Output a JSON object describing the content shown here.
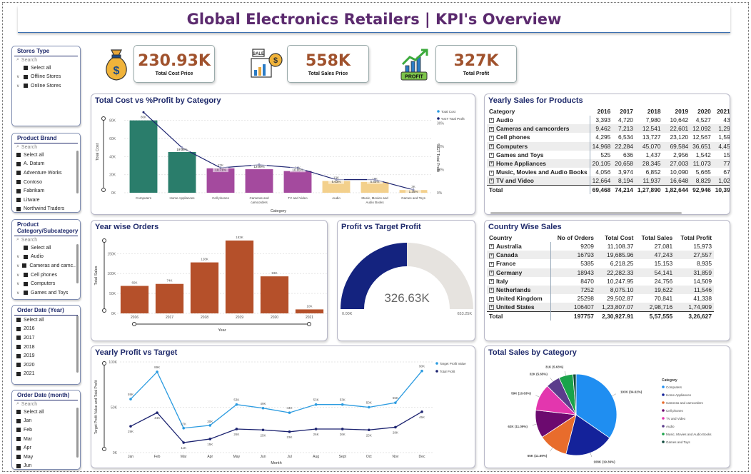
{
  "title": "Global Electronics Retailers | KPI's Overview",
  "kpis": [
    {
      "value": "230.93K",
      "label": "Total Cost Price",
      "icon": "money-bag-icon"
    },
    {
      "value": "558K",
      "label": "Total Sales Price",
      "icon": "sale-chart-icon"
    },
    {
      "value": "327K",
      "label": "Total Profit",
      "icon": "profit-chart-icon"
    }
  ],
  "slicers": {
    "stores": {
      "title": "Stores Type",
      "search": "Search",
      "items": [
        "Select all",
        "Offline Stores",
        "Online Stores"
      ]
    },
    "brand": {
      "title": "Product Brand",
      "search": "Search",
      "items": [
        "Select all",
        "A. Datum",
        "Adventure Works",
        "Contoso",
        "Fabrikam",
        "Litware",
        "Northwind Traders"
      ]
    },
    "category": {
      "title": "Product Category/Subcategory",
      "search": "Search",
      "items": [
        "Select all",
        "Audio",
        "Cameras and camc..",
        "Cell phones",
        "Computers",
        "Games and Toys"
      ]
    },
    "year": {
      "title": "Order Date (Year)",
      "items": [
        "Select all",
        "2016",
        "2017",
        "2018",
        "2019",
        "2020",
        "2021"
      ]
    },
    "month": {
      "title": "Order Date (month)",
      "search": "Search",
      "items": [
        "Select all",
        "Jan",
        "Feb",
        "Mar",
        "Apr",
        "May",
        "Jun"
      ]
    }
  },
  "cost_chart": {
    "title": "Total Cost vs %Profit by Category",
    "legend": [
      "Total Cost",
      "%GT Total Profit"
    ],
    "xlabel": "Category",
    "ylabel": "Total Cost",
    "y2label": "%GT Total Profit",
    "yticks": [
      "80K",
      "60K",
      "40K",
      "20K",
      "0K"
    ],
    "y2ticks": [
      "30%",
      "20%",
      "10%",
      "0%"
    ]
  },
  "year_chart": {
    "title": "Year wise Orders",
    "xlabel": "Year",
    "ylabel": "Total Sales",
    "yticks": [
      "150K",
      "100K",
      "50K",
      "0K"
    ]
  },
  "gauge": {
    "title": "Profit vs Target Profit",
    "value_label": "326.63K",
    "min_label": "0.00K",
    "max_label": "653.25K",
    "value": 326.63,
    "max": 653.25
  },
  "profit_chart": {
    "title": "Yearly Profit vs Target",
    "legend": [
      "Target Profit Value",
      "Total Profit"
    ],
    "xlabel": "Month",
    "ylabel": "Target Profit Value and Total Profit",
    "yticks": [
      "100K",
      "50K",
      "0K"
    ]
  },
  "pie_chart": {
    "title": "Total Sales by Category",
    "legend_title": "Category"
  },
  "yearly_sales": {
    "title": "Yearly Sales for Products",
    "headers": [
      "Category",
      "2016",
      "2017",
      "2018",
      "2019",
      "2020",
      "2021"
    ],
    "rows": [
      [
        "Audio",
        "3,393",
        "4,720",
        "7,980",
        "10,642",
        "4,527",
        "43"
      ],
      [
        "Cameras and camcorders",
        "9,462",
        "7,213",
        "12,541",
        "22,601",
        "12,092",
        "1,29"
      ],
      [
        "Cell phones",
        "4,295",
        "6,534",
        "13,727",
        "23,120",
        "12,567",
        "1,59"
      ],
      [
        "Computers",
        "14,968",
        "22,284",
        "45,070",
        "69,584",
        "36,651",
        "4,45"
      ],
      [
        "Games and Toys",
        "525",
        "636",
        "1,437",
        "2,956",
        "1,542",
        "15"
      ],
      [
        "Home Appliances",
        "20,105",
        "20,658",
        "28,345",
        "27,003",
        "11,073",
        "77"
      ],
      [
        "Music, Movies and Audio Books",
        "4,056",
        "3,974",
        "6,852",
        "10,090",
        "5,665",
        "67"
      ],
      [
        "TV and Video",
        "12,664",
        "8,194",
        "11,937",
        "16,648",
        "8,829",
        "1,02"
      ]
    ],
    "total": [
      "Total",
      "69,468",
      "74,214",
      "1,27,890",
      "1,82,644",
      "92,946",
      "10,39"
    ]
  },
  "country_sales": {
    "title": "Country Wise Sales",
    "headers": [
      "Country",
      "No of Orders",
      "Total Cost",
      "Total Sales",
      "Total Profit"
    ],
    "rows": [
      [
        "Australia",
        "9209",
        "11,108.37",
        "27,081",
        "15,973"
      ],
      [
        "Canada",
        "16793",
        "19,685.96",
        "47,243",
        "27,557"
      ],
      [
        "France",
        "5385",
        "6,218.25",
        "15,153",
        "8,935"
      ],
      [
        "Germany",
        "18943",
        "22,282.33",
        "54,141",
        "31,859"
      ],
      [
        "Italy",
        "8470",
        "10,247.95",
        "24,756",
        "14,509"
      ],
      [
        "Netherlands",
        "7252",
        "8,075.10",
        "19,622",
        "11,546"
      ],
      [
        "United Kingdom",
        "25298",
        "29,502.87",
        "70,841",
        "41,338"
      ],
      [
        "United States",
        "106407",
        "1,23,807.07",
        "2,98,716",
        "1,74,909"
      ]
    ],
    "total": [
      "Total",
      "197757",
      "2,30,927.91",
      "5,57,555",
      "3,26,627"
    ]
  },
  "chart_data": [
    {
      "type": "bar",
      "title": "Total Cost vs %Profit by Category",
      "categories": [
        "Computers",
        "Home Appliances",
        "Cell phones",
        "Cameras and camcorders",
        "TV and Video",
        "Audio",
        "Music, Movies and Audio Books",
        "Games and Toys"
      ],
      "series": [
        {
          "name": "Total Cost",
          "values": [
            80,
            45,
            27,
            26,
            24,
            13,
            12,
            3
          ],
          "labels": [
            "80K",
            "45K",
            "27K",
            "26K",
            "24K",
            "13K",
            "12K",
            "3K"
          ],
          "colors": [
            "#2a7d6b",
            "#2a7d6b",
            "#a44a9e",
            "#a44a9e",
            "#a44a9e",
            "#f3d08c",
            "#f3d08c",
            "#f3d08c"
          ]
        },
        {
          "name": "%GT Total Profit",
          "values": [
            34.62,
            19.36,
            10.71,
            12.0,
            10.65,
            5.63,
            5.65,
            1.25
          ],
          "labels": [
            "",
            "19.36%",
            "10.71%",
            "12.00%",
            "10.65%",
            "5.63%",
            "5.65%",
            "1.25%"
          ]
        }
      ],
      "ylim": [
        0,
        90
      ],
      "y2lim": [
        0,
        35
      ]
    },
    {
      "type": "bar",
      "title": "Year wise Orders",
      "categories": [
        "2016",
        "2017",
        "2018",
        "2019",
        "2020",
        "2021"
      ],
      "values": [
        69,
        74,
        128,
        183,
        93,
        10
      ],
      "labels": [
        "69K",
        "74K",
        "128K",
        "183K",
        "93K",
        "10K"
      ],
      "ylim": [
        0,
        190
      ]
    },
    {
      "type": "line",
      "title": "Yearly Profit vs Target",
      "categories": [
        "Jan",
        "Feb",
        "Mar",
        "Apr",
        "May",
        "Jun",
        "Jul",
        "Aug",
        "Sept",
        "Oct",
        "Nov",
        "Dec"
      ],
      "series": [
        {
          "name": "Target Profit Value",
          "values": [
            59,
            89,
            27,
            30,
            53,
            49,
            44,
            53,
            53,
            50,
            55,
            90
          ],
          "labels": [
            "59K",
            "89K",
            "27K",
            "30K",
            "53K",
            "49K",
            "44K",
            "53K",
            "53K",
            "50K",
            "55K",
            "90K"
          ],
          "color": "#2b9be0"
        },
        {
          "name": "Total Profit",
          "values": [
            29,
            44,
            11,
            15,
            26,
            25,
            23,
            26,
            26,
            25,
            28,
            45
          ],
          "labels": [
            "29K",
            "44K",
            "11K",
            "15K",
            "26K",
            "25K",
            "23K",
            "26K",
            "26K",
            "25K",
            "28K",
            "45K"
          ],
          "color": "#1c2370"
        }
      ],
      "ylim": [
        0,
        100
      ]
    },
    {
      "type": "pie",
      "title": "Total Sales by Category",
      "slices": [
        {
          "name": "Computers",
          "value": 34.62,
          "label": "193K (34.62%)",
          "color": "#1f8ef1"
        },
        {
          "name": "Home Appliances",
          "value": 19.36,
          "label": "108K (19.36%)",
          "color": "#14229a"
        },
        {
          "name": "Cameras and camcorders",
          "value": 11.69,
          "label": "65K (11.69%)",
          "color": "#e86c2c"
        },
        {
          "name": "Cell phones",
          "value": 11.09,
          "label": "62K (11.09%)",
          "color": "#6c0a6f"
        },
        {
          "name": "TV and Video",
          "value": 10.63,
          "label": "59K (10.63%)",
          "color": "#e336ae"
        },
        {
          "name": "Audio",
          "value": 5.65,
          "label": "32K (5.65%)",
          "color": "#5b3c8c"
        },
        {
          "name": "Music, Movies and Audio Books",
          "value": 5.63,
          "label": "31K (5.63%)",
          "color": "#1aa34a"
        },
        {
          "name": "Games and Toys",
          "value": 1.25,
          "label": "",
          "color": "#0f4a3c"
        }
      ]
    }
  ]
}
